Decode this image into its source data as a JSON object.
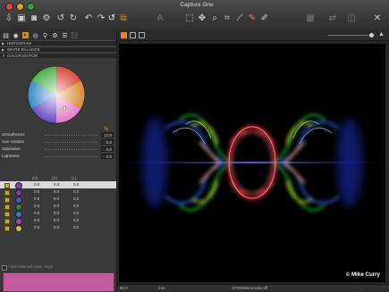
{
  "app": {
    "title": "Capture One"
  },
  "panel": {
    "sections": [
      {
        "label": "HISTOGRAM"
      },
      {
        "label": "WHITE BALANCE"
      },
      {
        "label": "COLOR EDITOR"
      }
    ],
    "sliders": [
      {
        "label": "Smoothness",
        "value": "12.0"
      },
      {
        "label": "Hue rotation",
        "value": "0.0"
      },
      {
        "label": "Saturation",
        "value": "0.0"
      },
      {
        "label": "Lightness",
        "value": "0.0"
      }
    ],
    "columns": {
      "h1": "(H)",
      "h2": "(S)",
      "h3": "(L)"
    },
    "rows": [
      {
        "color": "#8b3fa3",
        "h": "0.0",
        "s": "0.0",
        "l": "0.0"
      },
      {
        "color": "#6a42b0",
        "h": "0.0",
        "s": "0.0",
        "l": "0.0"
      },
      {
        "color": "#5a56b8",
        "h": "0.0",
        "s": "0.0",
        "l": "0.0"
      },
      {
        "color": "#2f8a3c",
        "h": "0.0",
        "s": "0.0",
        "l": "0.0"
      },
      {
        "color": "#3a76c2",
        "h": "0.0",
        "s": "0.0",
        "l": "0.0"
      },
      {
        "color": "#9a4aa8",
        "h": "0.0",
        "s": "0.0",
        "l": "0.0"
      },
      {
        "color": "#c9c23a",
        "h": "0.0",
        "s": "0.0",
        "l": "0.0"
      }
    ],
    "view_selected_label": "View selected color range",
    "swatch_color": "#c25c9e"
  },
  "viewer": {
    "zoom": "50.0",
    "mm": "mm",
    "filename": "CF006651smoke.tiff",
    "credit": "© Mike Curry"
  },
  "colors": {
    "accent": "#e08a1e"
  }
}
